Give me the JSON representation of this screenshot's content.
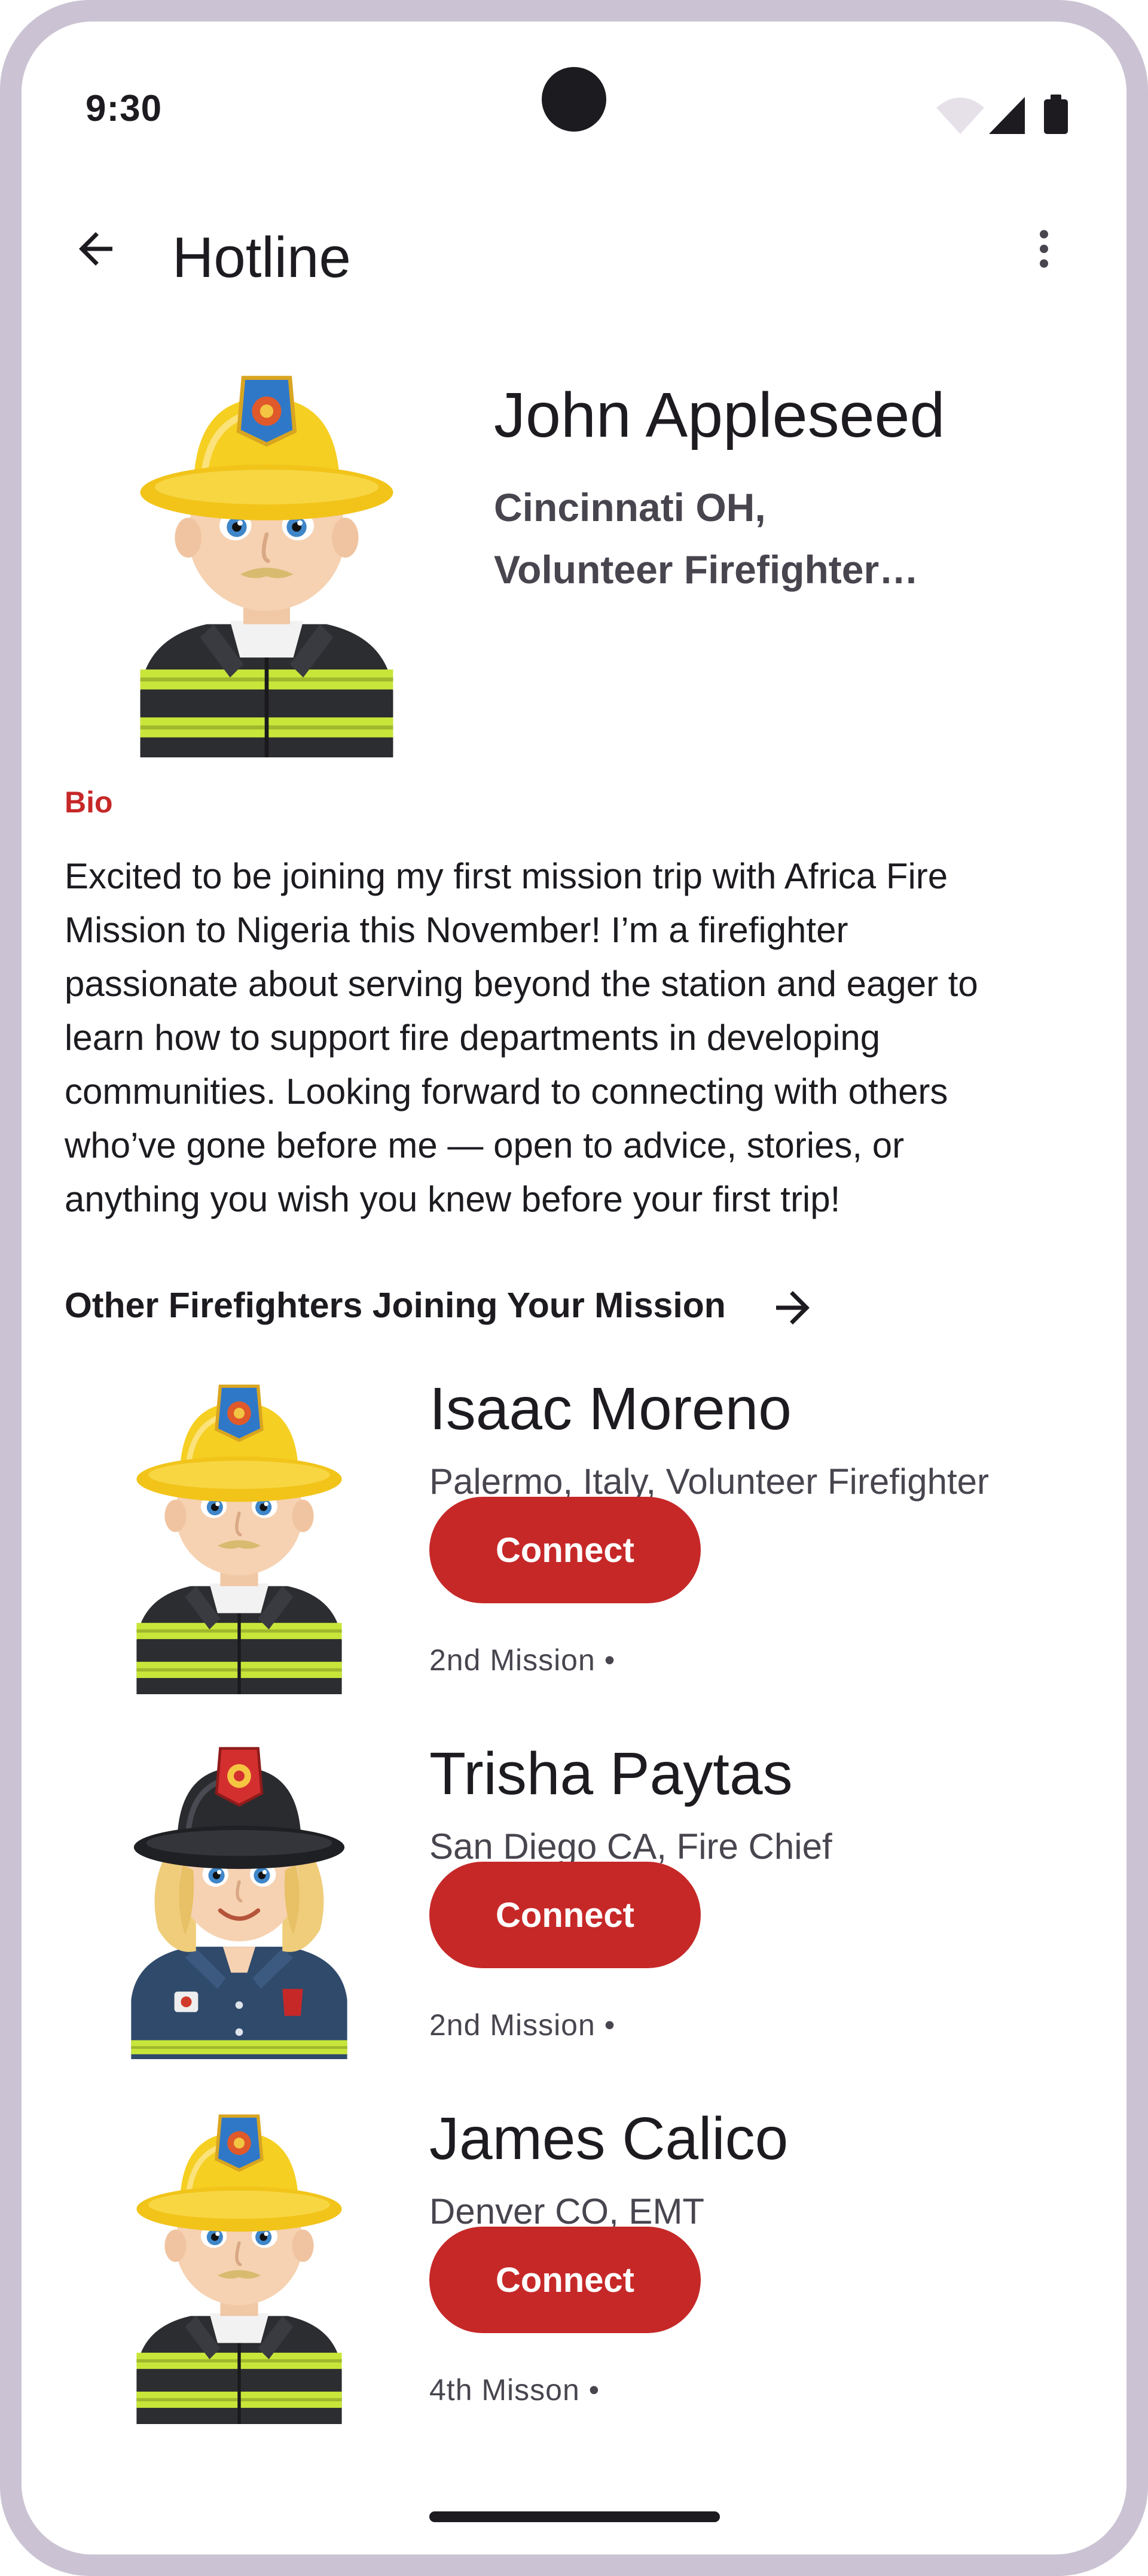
{
  "status_bar": {
    "time": "9:30",
    "icons": [
      "wifi-icon",
      "cellular-signal-icon",
      "battery-icon"
    ]
  },
  "app_bar": {
    "title": "Hotline",
    "back_icon": "arrow-back-icon",
    "menu_icon": "more-vert-icon"
  },
  "profile": {
    "name": "John Appleseed",
    "subtitle_line1": "Cincinnati OH,",
    "subtitle_line2": "Volunteer Firefighter…",
    "avatar": "firefighter-yellow-helmet-avatar"
  },
  "bio": {
    "label": "Bio",
    "text": "Excited to be joining my first mission trip with Africa Fire\nMission to Nigeria this November! I’m a firefighter\npassionate about serving beyond the station and eager to\nlearn how to support fire departments in developing\ncommunities. Looking forward to connecting with others\nwho’ve gone before me — open to advice, stories, or\nanything you wish you knew before your first trip!"
  },
  "section": {
    "title": "Other Firefighters Joining Your Mission",
    "arrow_icon": "arrow-forward-icon"
  },
  "firefighters": [
    {
      "name": "Isaac Moreno",
      "location": "Palermo, Italy, Volunteer Firefighter",
      "button_label": "Connect",
      "meta": "2nd Mission •",
      "avatar": "firefighter-yellow-helmet-avatar"
    },
    {
      "name": "Trisha Paytas",
      "location": "San Diego CA, Fire Chief",
      "button_label": "Connect",
      "meta": "2nd Mission •",
      "avatar": "fire-chief-black-helmet-avatar"
    },
    {
      "name": "James Calico",
      "location": "Denver CO, EMT",
      "button_label": "Connect",
      "meta": "4th Misson •",
      "avatar": "firefighter-yellow-helmet-avatar"
    }
  ],
  "colors": {
    "accent": "#c62828",
    "frame": "#cbc3d3",
    "text_primary": "#1d1b20",
    "text_secondary": "#49454f"
  }
}
